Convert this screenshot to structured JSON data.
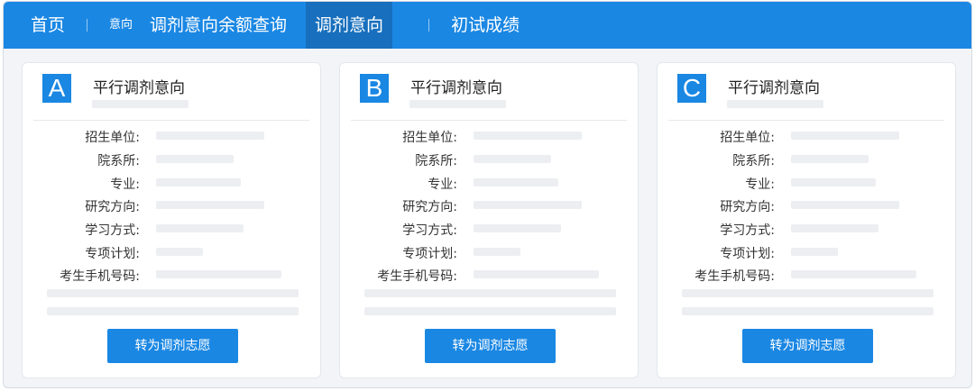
{
  "nav": {
    "home": "首页",
    "intent_small": "意向",
    "query": "调剂意向余额查询",
    "intent": "调剂意向",
    "score": "初试成绩"
  },
  "cards": [
    {
      "badge": "A",
      "title": "平行调剂意向",
      "fields": [
        "招生单位:",
        "院系所:",
        "专业:",
        "研究方向:",
        "学习方式:",
        "专项计划:",
        "考生手机号码:"
      ],
      "button": "转为调剂志愿"
    },
    {
      "badge": "B",
      "title": "平行调剂意向",
      "fields": [
        "招生单位:",
        "院系所:",
        "专业:",
        "研究方向:",
        "学习方式:",
        "专项计划:",
        "考生手机号码:"
      ],
      "button": "转为调剂志愿"
    },
    {
      "badge": "C",
      "title": "平行调剂意向",
      "fields": [
        "招生单位:",
        "院系所:",
        "专业:",
        "研究方向:",
        "学习方式:",
        "专项计划:",
        "考生手机号码:"
      ],
      "button": "转为调剂志愿"
    }
  ],
  "colors": {
    "primary": "#1a87e3",
    "nav_active": "#176fbd",
    "placeholder": "#eceef1",
    "background": "#f2f4f7"
  }
}
